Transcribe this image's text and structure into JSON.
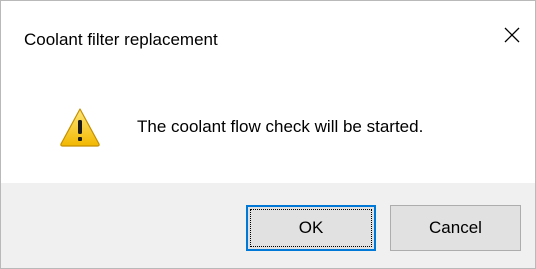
{
  "dialog": {
    "title": "Coolant filter replacement",
    "close_icon": "close-icon",
    "message": "The coolant flow check will be started.",
    "icon": "warning-icon",
    "buttons": {
      "ok_label": "OK",
      "cancel_label": "Cancel"
    }
  },
  "colors": {
    "footer_bg": "#f0f0f0",
    "button_bg": "#e1e1e1",
    "focus_border": "#0078d7",
    "warning_yellow": "#f7c600"
  }
}
